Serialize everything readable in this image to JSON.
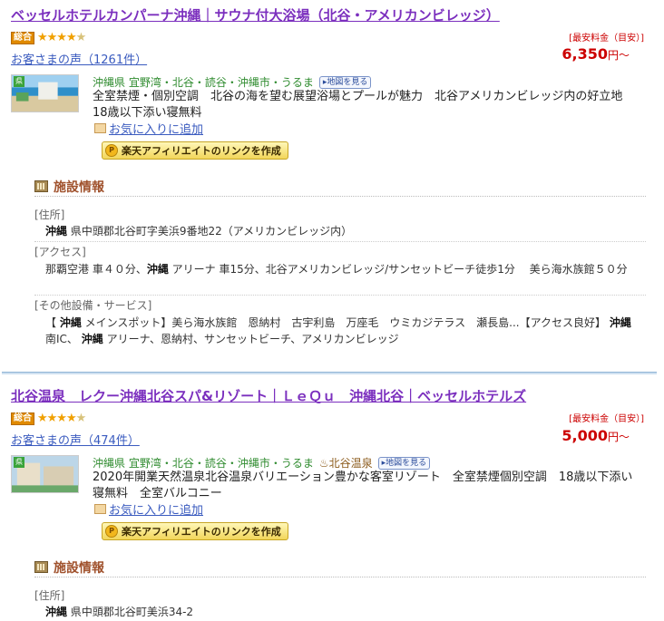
{
  "hotels": [
    {
      "name": "ベッセルホテルカンパーナ沖縄｜サウナ付大浴場（北谷・アメリカンビレッジ）",
      "rating_badge": "総合",
      "stars": "★★★★",
      "half_star": "★",
      "voice": "お客さまの声（1261件）",
      "price_label": "[最安料金（目安）]",
      "price": "6,350",
      "price_suffix": "円〜",
      "thumb_badge": "県",
      "area": "沖縄県 宜野湾・北谷・読谷・沖縄市・うるま",
      "onsen": "",
      "map_button": "▸地図を見る",
      "description": "全室禁煙・個別空調　北谷の海を望む展望浴場とプールが魅力　北谷アメリカンビレッジ内の好立地　18歳以下添い寝無料",
      "favorite": "お気に入りに追加",
      "affiliate_coin": "P",
      "affiliate": "楽天アフィリエイトのリンクを作成",
      "facility_title": "施設情報",
      "address_label": "[住所]",
      "address_pref": "沖縄",
      "address_rest": " 県中頭郡北谷町字美浜9番地22（アメリカンビレッジ内）",
      "access_label": "[アクセス]",
      "access_1": "那覇空港 車４０分、",
      "access_pref": "沖縄",
      "access_2": " アリーナ 車15分、北谷アメリカンビレッジ/サンセットビーチ徒歩1分　 美ら海水族館５０分",
      "other_label": "[その他設備・サービス]",
      "other_1": "【 ",
      "other_pref1": "沖縄",
      "other_2": " メインスポット】美ら海水族館　恩納村　古宇利島　万座毛　ウミカジテラス　瀬長島...【アクセス良好】 ",
      "other_pref2": "沖縄",
      "other_3": " 南IC、 ",
      "other_pref3": "沖縄",
      "other_4": " アリーナ、恩納村、サンセットビーチ、アメリカンビレッジ"
    },
    {
      "name": "北谷温泉　レクー沖縄北谷スパ&リゾート｜ＬｅＱｕ　沖縄北谷｜ベッセルホテルズ",
      "rating_badge": "総合",
      "stars": "★★★★",
      "half_star": "★",
      "voice": "お客さまの声（474件）",
      "price_label": "[最安料金（目安）]",
      "price": "5,000",
      "price_suffix": "円〜",
      "thumb_badge": "県",
      "area": "沖縄県 宜野湾・北谷・読谷・沖縄市・うるま",
      "onsen": "♨北谷温泉",
      "map_button": "▸地図を見る",
      "description": "2020年開業天然温泉北谷温泉バリエーション豊かな客室リゾート　全室禁煙個別空調　18歳以下添い寝無料　全室バルコニー",
      "favorite": "お気に入りに追加",
      "affiliate_coin": "P",
      "affiliate": "楽天アフィリエイトのリンクを作成",
      "facility_title": "施設情報",
      "address_label": "[住所]",
      "address_pref": "沖縄",
      "address_rest": " 県中頭郡北谷町美浜34-2"
    }
  ]
}
